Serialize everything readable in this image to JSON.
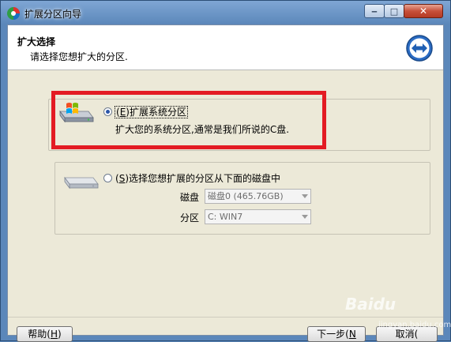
{
  "window": {
    "title": "扩展分区向导",
    "controls": {
      "minimize": "‒",
      "maximize": "□",
      "close": "✕"
    }
  },
  "header": {
    "title": "扩大选择",
    "subtitle": "请选择您想扩大的分区.",
    "icon": "wizard-arrows-icon"
  },
  "options": {
    "option1": {
      "accel": "E",
      "label": "扩展系统分区",
      "description": "扩大您的系统分区,通常是我们所说的C盘.",
      "checked": true,
      "icon": "windows-drive-icon"
    },
    "option2": {
      "accel": "S",
      "label": "选择您想扩展的分区从下面的磁盘中",
      "checked": false,
      "icon": "drive-icon",
      "disk_label": "磁盘",
      "disk_value": "磁盘0 (465.76GB)",
      "partition_label": "分区",
      "partition_value": "C: WIN7"
    }
  },
  "buttons": {
    "help": "帮助(",
    "help_accel": "H",
    "help_end": ")",
    "next": "下一步(",
    "next_accel": "N",
    "cancel": "取消("
  },
  "watermark": {
    "brand": "Baidu",
    "url": "jingyan.baidu.com"
  },
  "colors": {
    "highlight": "#e31b23",
    "titlebar": "#5b87ba"
  }
}
